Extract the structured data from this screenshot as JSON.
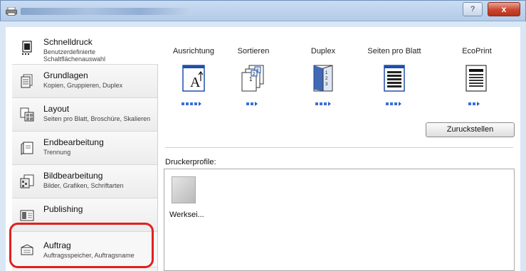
{
  "window": {
    "help_label": "?",
    "close_label": "x"
  },
  "sidebar": {
    "items": [
      {
        "title": "Schnelldruck",
        "subtitle": "Benutzerdefinierte Schaltflächenauswahl",
        "icon": "quick-print-icon",
        "selected": true
      },
      {
        "title": "Grundlagen",
        "subtitle": "Kopien, Gruppieren, Duplex",
        "icon": "basics-icon"
      },
      {
        "title": "Layout",
        "subtitle": "Seiten pro Blatt, Broschüre, Skalieren",
        "icon": "layout-icon"
      },
      {
        "title": "Endbearbeitung",
        "subtitle": "Trennung",
        "icon": "finishing-icon"
      },
      {
        "title": "Bildbearbeitung",
        "subtitle": "Bilder, Grafiken, Schriftarten",
        "icon": "imaging-icon"
      },
      {
        "title": "Publishing",
        "subtitle": "",
        "icon": "publishing-icon"
      },
      {
        "title": "Auftrag",
        "subtitle": "Auftragsspeicher, Auftragsname",
        "icon": "job-icon"
      }
    ]
  },
  "quickprint": {
    "columns": [
      {
        "label": "Ausrichtung",
        "icon": "orientation-icon",
        "dots": 4
      },
      {
        "label": "Sortieren",
        "icon": "collate-icon",
        "dots": 2
      },
      {
        "label": "Duplex",
        "icon": "duplex-icon",
        "dots": 3
      },
      {
        "label": "Seiten pro Blatt",
        "icon": "pages-per-sheet-icon",
        "dots": 3
      },
      {
        "label": "EcoPrint",
        "icon": "ecoprint-icon",
        "dots": 2
      }
    ],
    "reset_label": "Zuruckstellen"
  },
  "profiles": {
    "label": "Druckerprofile:",
    "items": [
      {
        "name": "Werksei..."
      }
    ]
  },
  "colors": {
    "accent": "#3a6fd8",
    "highlight": "#e02020",
    "close": "#c9452d"
  }
}
